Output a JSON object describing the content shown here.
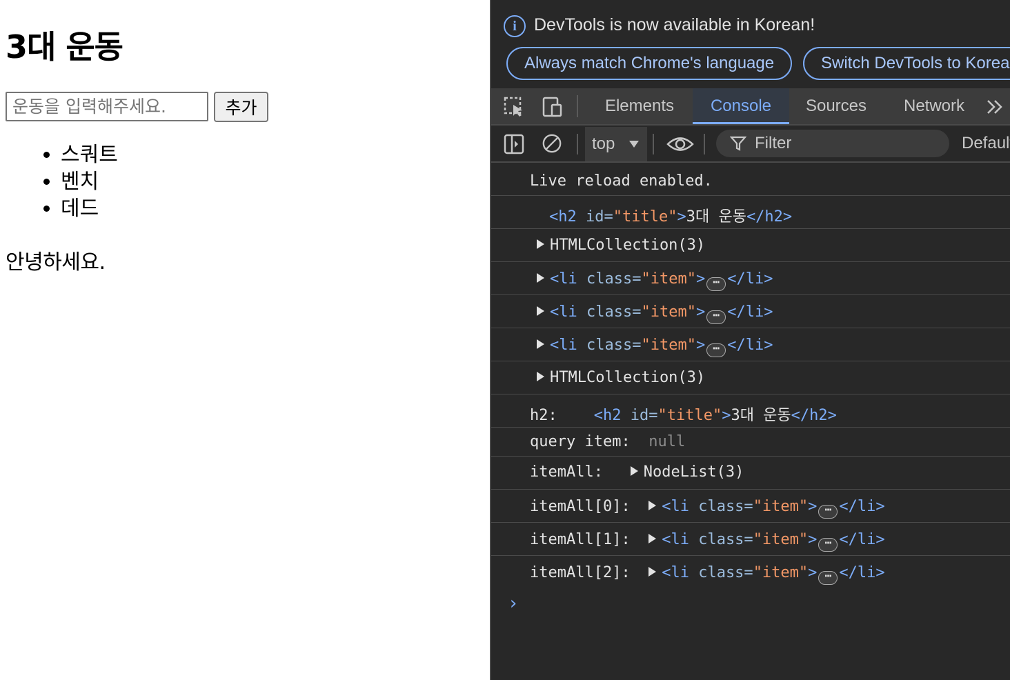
{
  "page": {
    "title": "3대 운동",
    "input_placeholder": "운동을 입력해주세요.",
    "add_button": "추가",
    "items": [
      "스쿼트",
      "벤치",
      "데드"
    ],
    "greeting": "안녕하세요."
  },
  "devtools": {
    "info": {
      "text": "DevTools is now available in Korean!",
      "match_button": "Always match Chrome's language",
      "switch_button": "Switch DevTools to Korean"
    },
    "tabs": [
      "Elements",
      "Console",
      "Sources",
      "Network"
    ],
    "active_tab": "Console",
    "more_tabs_icon": "chevron-double-right-icon",
    "toolbar": {
      "context": "top",
      "filter_placeholder": "Filter",
      "levels": "Default levels"
    },
    "console": {
      "live_reload": "Live reload enabled.",
      "h2_open": "<h2",
      "h2_attr": "id=",
      "h2_val": "\"title\"",
      "h2_close_bracket": ">",
      "h2_text": "3대 운동",
      "h2_end": "</h2>",
      "html_collection": "HTMLCollection(3)",
      "li_open": "<li",
      "li_attr": "class=",
      "li_val": "\"item\"",
      "li_close_bracket": ">",
      "li_end": "</li>",
      "ellipsis": "⋯",
      "label_h2": "h2:",
      "label_query": "query item:",
      "null_value": "null",
      "label_itemall": "itemAll:",
      "nodelist": "NodeList(3)",
      "label_item0": "itemAll[0]:",
      "label_item1": "itemAll[1]:",
      "label_item2": "itemAll[2]:",
      "prompt": "›"
    }
  }
}
